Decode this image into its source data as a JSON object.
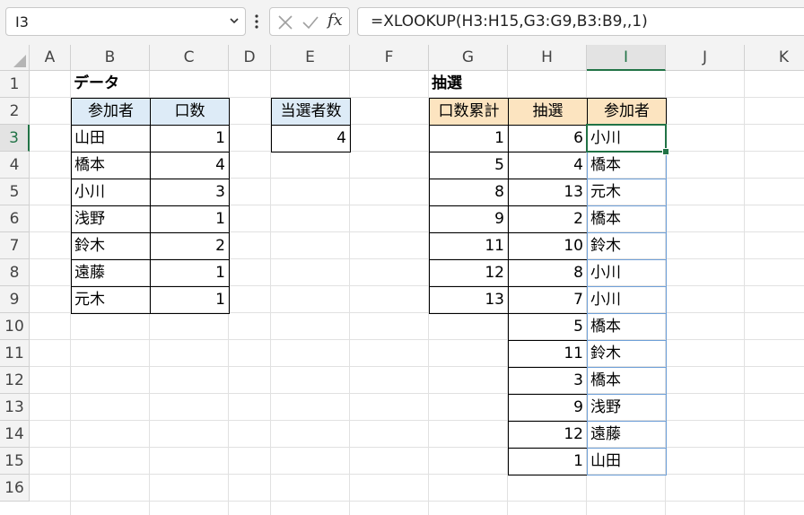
{
  "formula_bar": {
    "name_box": "I3",
    "fx_label": "fx",
    "formula": "=XLOOKUP(H3:H15,G3:G9,B3:B9,,1)"
  },
  "columns": [
    "A",
    "B",
    "C",
    "D",
    "E",
    "F",
    "G",
    "H",
    "I",
    "J",
    "K"
  ],
  "rows": [
    "1",
    "2",
    "3",
    "4",
    "5",
    "6",
    "7",
    "8",
    "9",
    "10",
    "11",
    "12",
    "13",
    "14",
    "15",
    "16"
  ],
  "selected": {
    "column": "I",
    "row": "3"
  },
  "data_table": {
    "title": "データ",
    "headers": [
      "参加者",
      "口数"
    ],
    "rows": [
      [
        "山田",
        "1"
      ],
      [
        "橋本",
        "4"
      ],
      [
        "小川",
        "3"
      ],
      [
        "浅野",
        "1"
      ],
      [
        "鈴木",
        "2"
      ],
      [
        "遠藤",
        "1"
      ],
      [
        "元木",
        "1"
      ]
    ]
  },
  "winners": {
    "header": "当選者数",
    "value": "4"
  },
  "lottery": {
    "title": "抽選",
    "headers": [
      "口数累計",
      "抽選",
      "参加者"
    ],
    "cumulative": [
      "1",
      "5",
      "8",
      "9",
      "11",
      "12",
      "13"
    ],
    "draws": [
      "6",
      "4",
      "13",
      "2",
      "10",
      "8",
      "7",
      "5",
      "11",
      "3",
      "9",
      "12",
      "1"
    ],
    "names": [
      "小川",
      "橋本",
      "元木",
      "橋本",
      "鈴木",
      "小川",
      "小川",
      "橋本",
      "鈴木",
      "橋本",
      "浅野",
      "遠藤",
      "山田"
    ]
  }
}
